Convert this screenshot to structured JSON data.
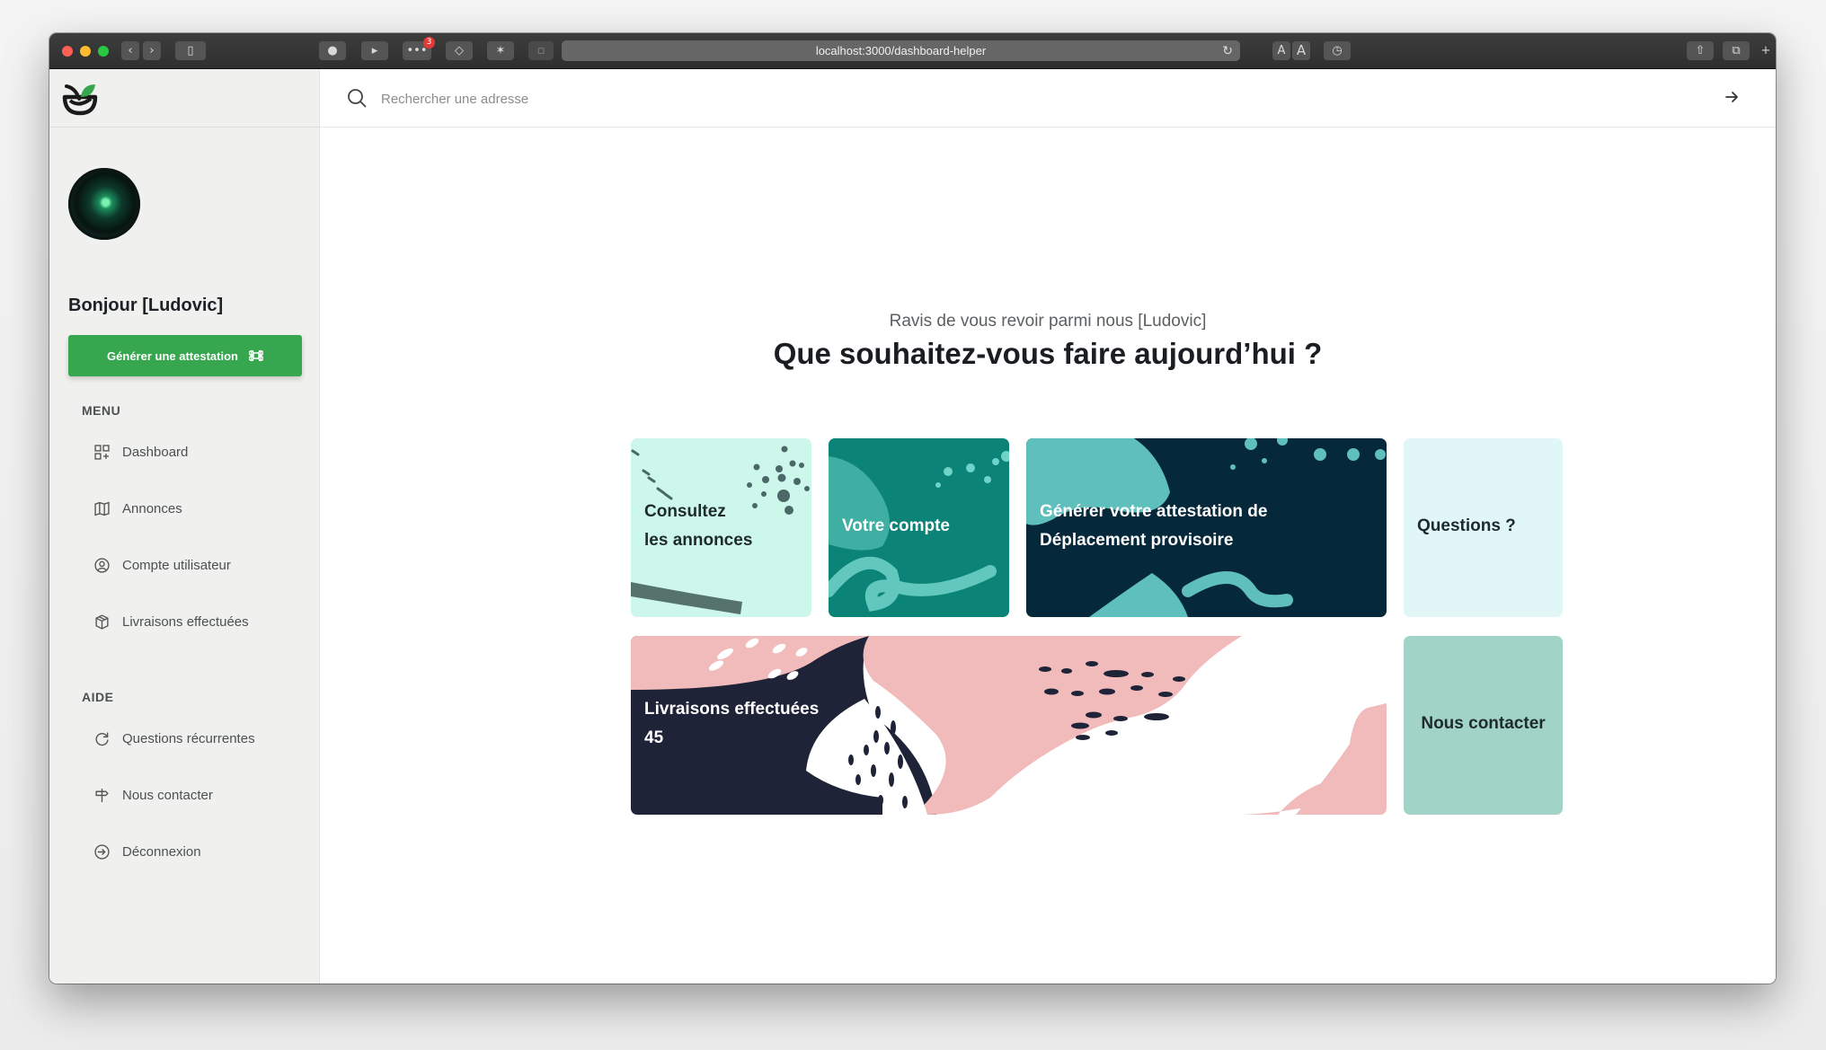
{
  "browser": {
    "url": "localhost:3000/dashboard-helper",
    "extension_badge": "3",
    "text_size_small": "A",
    "text_size_large": "A"
  },
  "sidebar": {
    "greeting": "Bonjour [Ludovic]",
    "cta_label": "Générer une attestation",
    "menu_title": "MENU",
    "menu_items": [
      {
        "label": "Dashboard",
        "icon": "grid-icon"
      },
      {
        "label": "Annonces",
        "icon": "map-icon"
      },
      {
        "label": "Compte utilisateur",
        "icon": "user-circle-icon"
      },
      {
        "label": "Livraisons effectuées",
        "icon": "package-icon"
      }
    ],
    "help_title": "AIDE",
    "help_items": [
      {
        "label": "Questions récurrentes",
        "icon": "refresh-icon"
      },
      {
        "label": "Nous contacter",
        "icon": "signpost-icon"
      },
      {
        "label": "Déconnexion",
        "icon": "logout-icon"
      }
    ]
  },
  "search": {
    "placeholder": "Rechercher une adresse",
    "value": ""
  },
  "main": {
    "subtitle": "Ravis de vous revoir parmi nous [Ludovic]",
    "title": "Que souhaitez-vous faire aujourd’hui ?",
    "cards": {
      "annonces": {
        "line1": "Consultez",
        "line2": "les annonces"
      },
      "compte": {
        "label": "Votre compte"
      },
      "attestation": {
        "line1": "Générer votre attestation de",
        "line2": "Déplacement provisoire"
      },
      "questions": {
        "label": "Questions ?"
      },
      "livraisons": {
        "line1": "Livraisons effectuées",
        "count": "45"
      },
      "contact": {
        "label": "Nous contacter"
      }
    }
  },
  "colors": {
    "accent_green": "#36a64f",
    "mint": "#cdf7ea",
    "teal": "#0b8376",
    "dark_navy": "#05283a",
    "pale_cyan": "#e1f7f7",
    "pink": "#f2bbbb",
    "sage": "#a1d4c6"
  }
}
